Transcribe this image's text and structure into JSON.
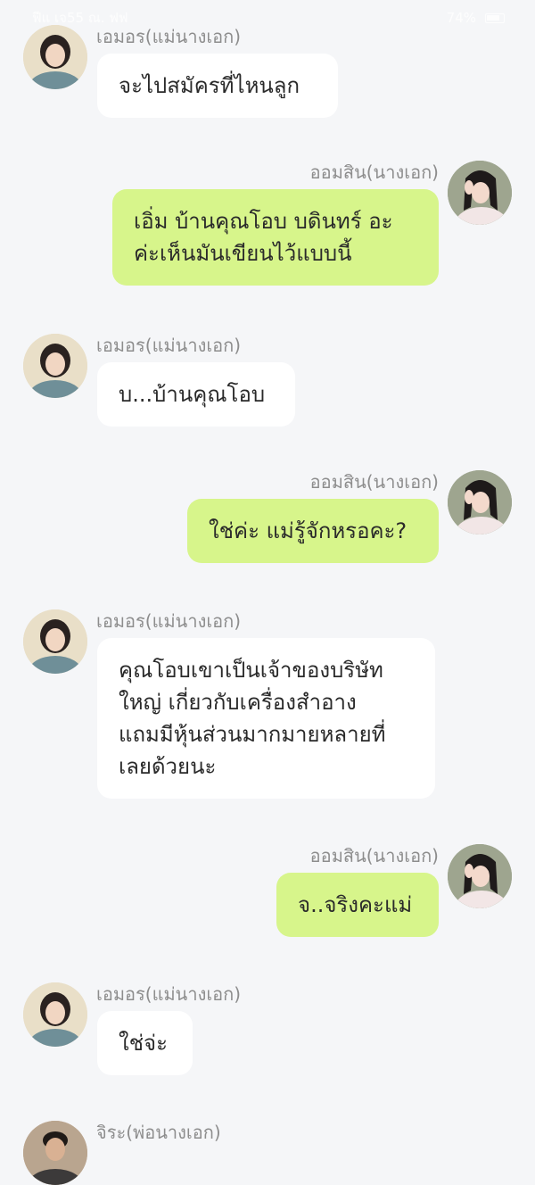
{
  "status_bar": {
    "left_text": "ฟีแ เจ55 ณ. ฟฟ",
    "right_text": "74%"
  },
  "messages": [
    {
      "side": "left",
      "avatar": "mother-avatar",
      "name": "เอมอร(แม่นางเอก)",
      "lines": [
        "จะไปสมัครที่ไหนลูก"
      ]
    },
    {
      "side": "right",
      "avatar": "heroine-avatar",
      "name": "ออมสิน(นางเอก)",
      "lines": [
        "เอิ่ม บ้านคุณโอบ บดินทร์ อะ",
        "ค่ะเห็นมันเขียนไว้แบบนี้"
      ]
    },
    {
      "side": "left",
      "avatar": "mother-avatar",
      "name": "เอมอร(แม่นางเอก)",
      "lines": [
        "บ...บ้านคุณโอบ"
      ]
    },
    {
      "side": "right",
      "avatar": "heroine-avatar",
      "name": "ออมสิน(นางเอก)",
      "lines": [
        "ใช่ค่ะ แม่รู้จักหรอคะ?"
      ]
    },
    {
      "side": "left",
      "avatar": "mother-avatar",
      "name": "เอมอร(แม่นางเอก)",
      "lines": [
        "คุณโอบเขาเป็นเจ้าของบริษัท",
        "ใหญ่ เกี่ยวกับเครื่องสำอาง",
        "แถมมีหุ้นส่วนมากมายหลายที่",
        "เลยด้วยนะ"
      ]
    },
    {
      "side": "right",
      "avatar": "heroine-avatar",
      "name": "ออมสิน(นางเอก)",
      "lines": [
        "จ..จริงคะแม่"
      ]
    },
    {
      "side": "left",
      "avatar": "mother-avatar",
      "name": "เอมอร(แม่นางเอก)",
      "lines": [
        "ใช่จ่ะ"
      ]
    },
    {
      "side": "left",
      "avatar": "father-avatar",
      "name": "จิระ(พ่อนางเอก)",
      "lines": []
    }
  ],
  "colors": {
    "background": "#f5f6f8",
    "bubble_left": "#ffffff",
    "bubble_right": "#d7f58b",
    "name_text": "#8d8d8d"
  }
}
